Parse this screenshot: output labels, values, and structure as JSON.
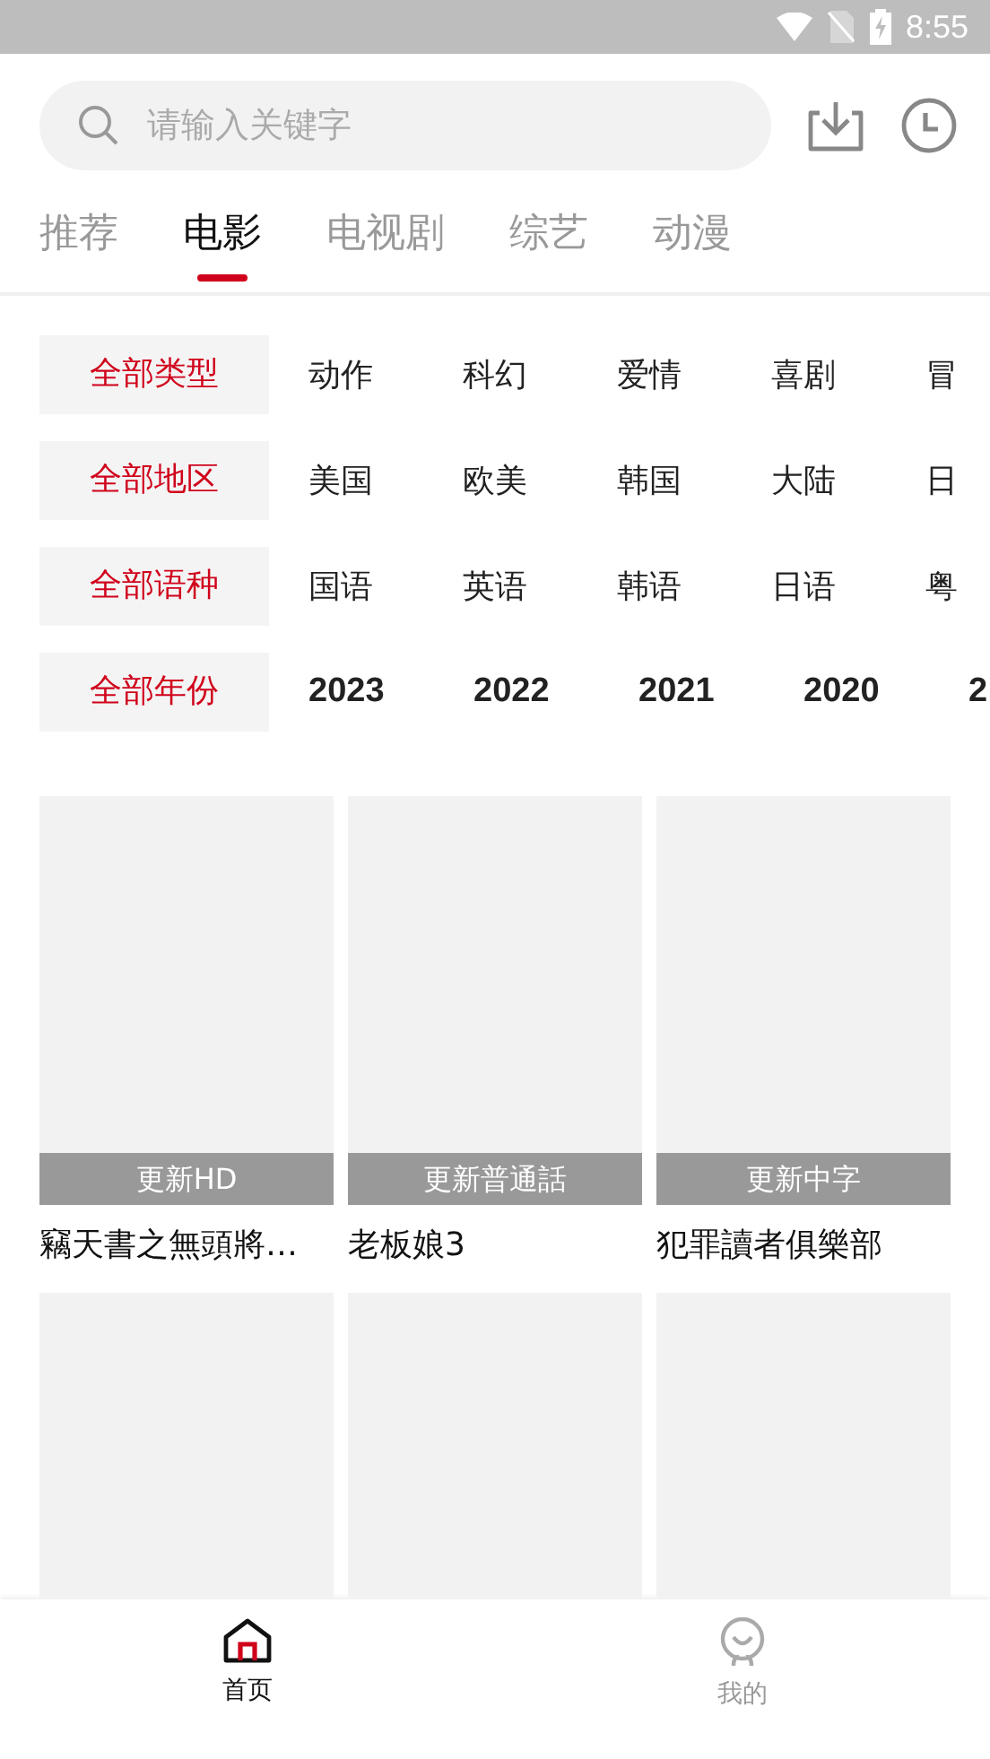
{
  "status_bar": {
    "time": "8:55"
  },
  "search": {
    "placeholder": "请输入关键字"
  },
  "tabs": [
    {
      "label": "推荐",
      "selected": false
    },
    {
      "label": "电影",
      "selected": true
    },
    {
      "label": "电视剧",
      "selected": false
    },
    {
      "label": "综艺",
      "selected": false
    },
    {
      "label": "动漫",
      "selected": false
    }
  ],
  "filters": [
    {
      "kind": "text",
      "options": [
        {
          "label": "全部类型",
          "selected": true
        },
        {
          "label": "动作",
          "selected": false
        },
        {
          "label": "科幻",
          "selected": false
        },
        {
          "label": "爱情",
          "selected": false
        },
        {
          "label": "喜剧",
          "selected": false
        },
        {
          "label": "冒",
          "selected": false
        }
      ]
    },
    {
      "kind": "text",
      "options": [
        {
          "label": "全部地区",
          "selected": true
        },
        {
          "label": "美国",
          "selected": false
        },
        {
          "label": "欧美",
          "selected": false
        },
        {
          "label": "韩国",
          "selected": false
        },
        {
          "label": "大陆",
          "selected": false
        },
        {
          "label": "日",
          "selected": false
        }
      ]
    },
    {
      "kind": "text",
      "options": [
        {
          "label": "全部语种",
          "selected": true
        },
        {
          "label": "国语",
          "selected": false
        },
        {
          "label": "英语",
          "selected": false
        },
        {
          "label": "韩语",
          "selected": false
        },
        {
          "label": "日语",
          "selected": false
        },
        {
          "label": "粤",
          "selected": false
        }
      ]
    },
    {
      "kind": "year",
      "options": [
        {
          "label": "全部年份",
          "selected": true
        },
        {
          "label": "2023",
          "selected": false
        },
        {
          "label": "2022",
          "selected": false
        },
        {
          "label": "2021",
          "selected": false
        },
        {
          "label": "2020",
          "selected": false
        },
        {
          "label": "2",
          "selected": false
        }
      ]
    }
  ],
  "cards": [
    {
      "kind": "captioned",
      "badge": "更新HD",
      "title": "竊天書之無頭將…"
    },
    {
      "kind": "captioned",
      "badge": "更新普通話",
      "title": "老板娘3"
    },
    {
      "kind": "captioned",
      "badge": "更新中字",
      "title": "犯罪讀者俱樂部"
    },
    {
      "kind": "bare"
    },
    {
      "kind": "bare"
    },
    {
      "kind": "bare"
    }
  ],
  "bottom_nav": [
    {
      "label": "首页",
      "selected": true
    },
    {
      "label": "我的",
      "selected": false
    }
  ]
}
